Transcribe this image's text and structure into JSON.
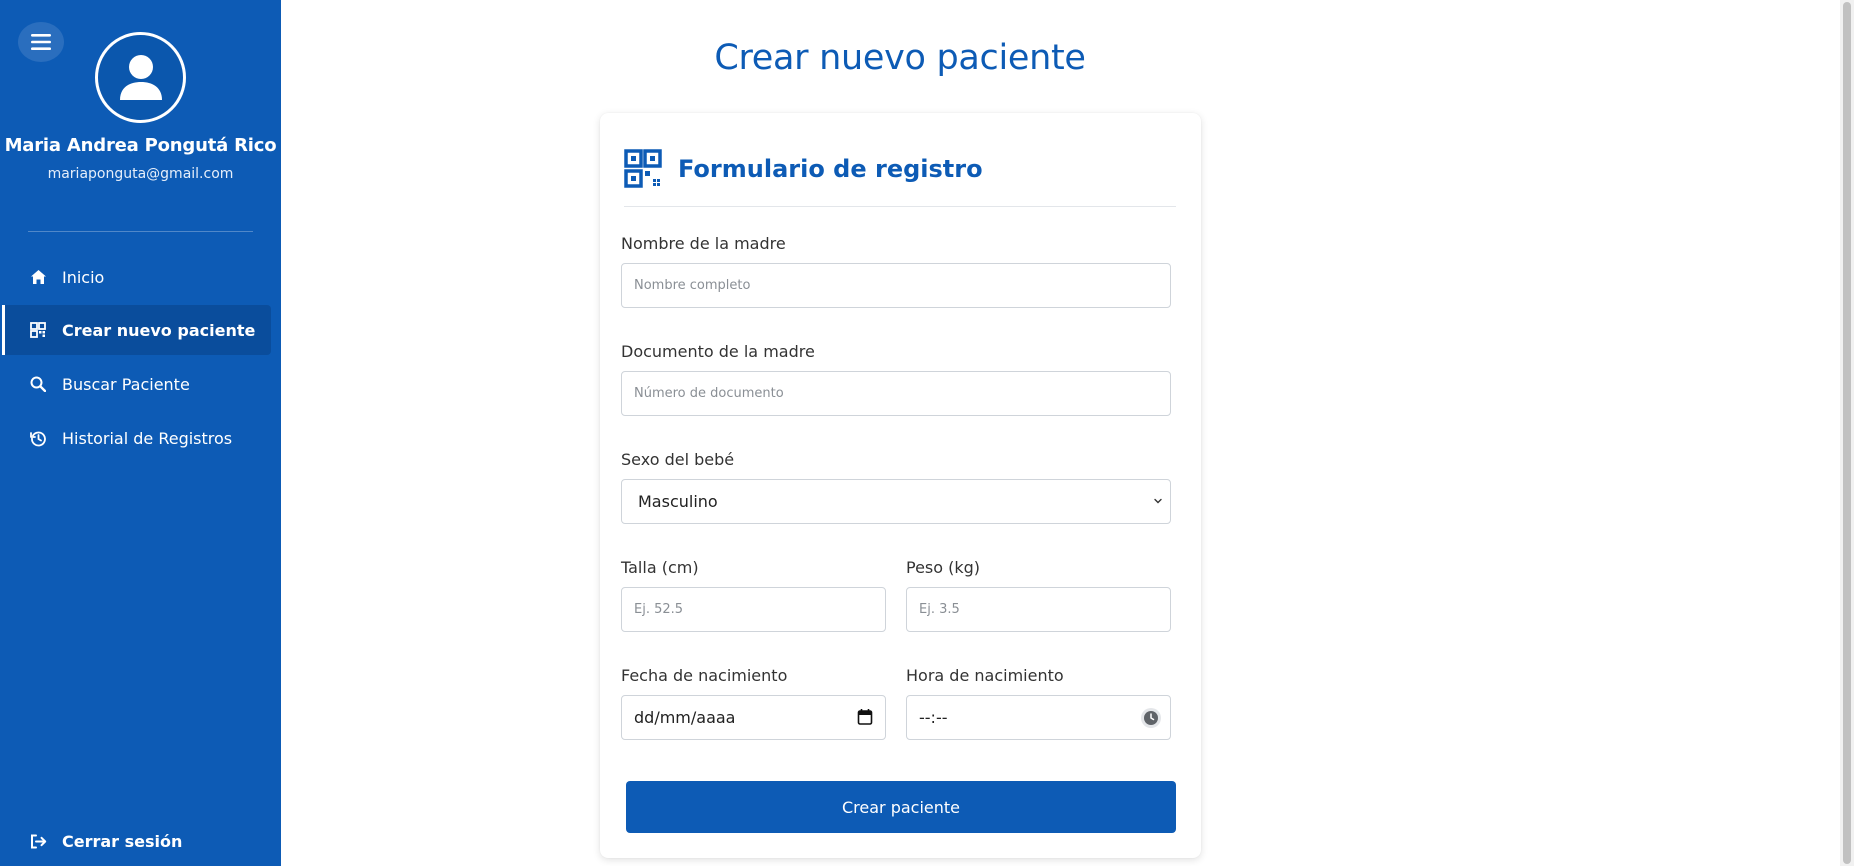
{
  "user": {
    "name": "Maria Andrea Pongutá Rico",
    "email": "mariaponguta@gmail.com"
  },
  "sidebar": {
    "items": [
      {
        "label": "Inicio",
        "icon": "home-icon"
      },
      {
        "label": "Crear nuevo paciente",
        "icon": "qr-grid-icon",
        "active": true
      },
      {
        "label": "Buscar Paciente",
        "icon": "search-icon"
      },
      {
        "label": "Historial de Registros",
        "icon": "history-icon"
      }
    ],
    "logout_label": "Cerrar sesión"
  },
  "main": {
    "title": "Crear nuevo paciente",
    "form": {
      "title": "Formulario de registro",
      "mother_name": {
        "label": "Nombre de la madre",
        "placeholder": "Nombre completo"
      },
      "mother_document": {
        "label": "Documento de la madre",
        "placeholder": "Número de documento"
      },
      "baby_sex": {
        "label": "Sexo del bebé",
        "value": "Masculino"
      },
      "height": {
        "label": "Talla (cm)",
        "placeholder": "Ej. 52.5"
      },
      "weight": {
        "label": "Peso (kg)",
        "placeholder": "Ej. 3.5"
      },
      "birth_date": {
        "label": "Fecha de nacimiento",
        "value": "dd/mm/aaaa"
      },
      "birth_time": {
        "label": "Hora de nacimiento",
        "value": "--:--"
      },
      "submit_label": "Crear paciente"
    }
  },
  "colors": {
    "brand": "#0d5bb5",
    "active_item": "#0a4d9c"
  }
}
